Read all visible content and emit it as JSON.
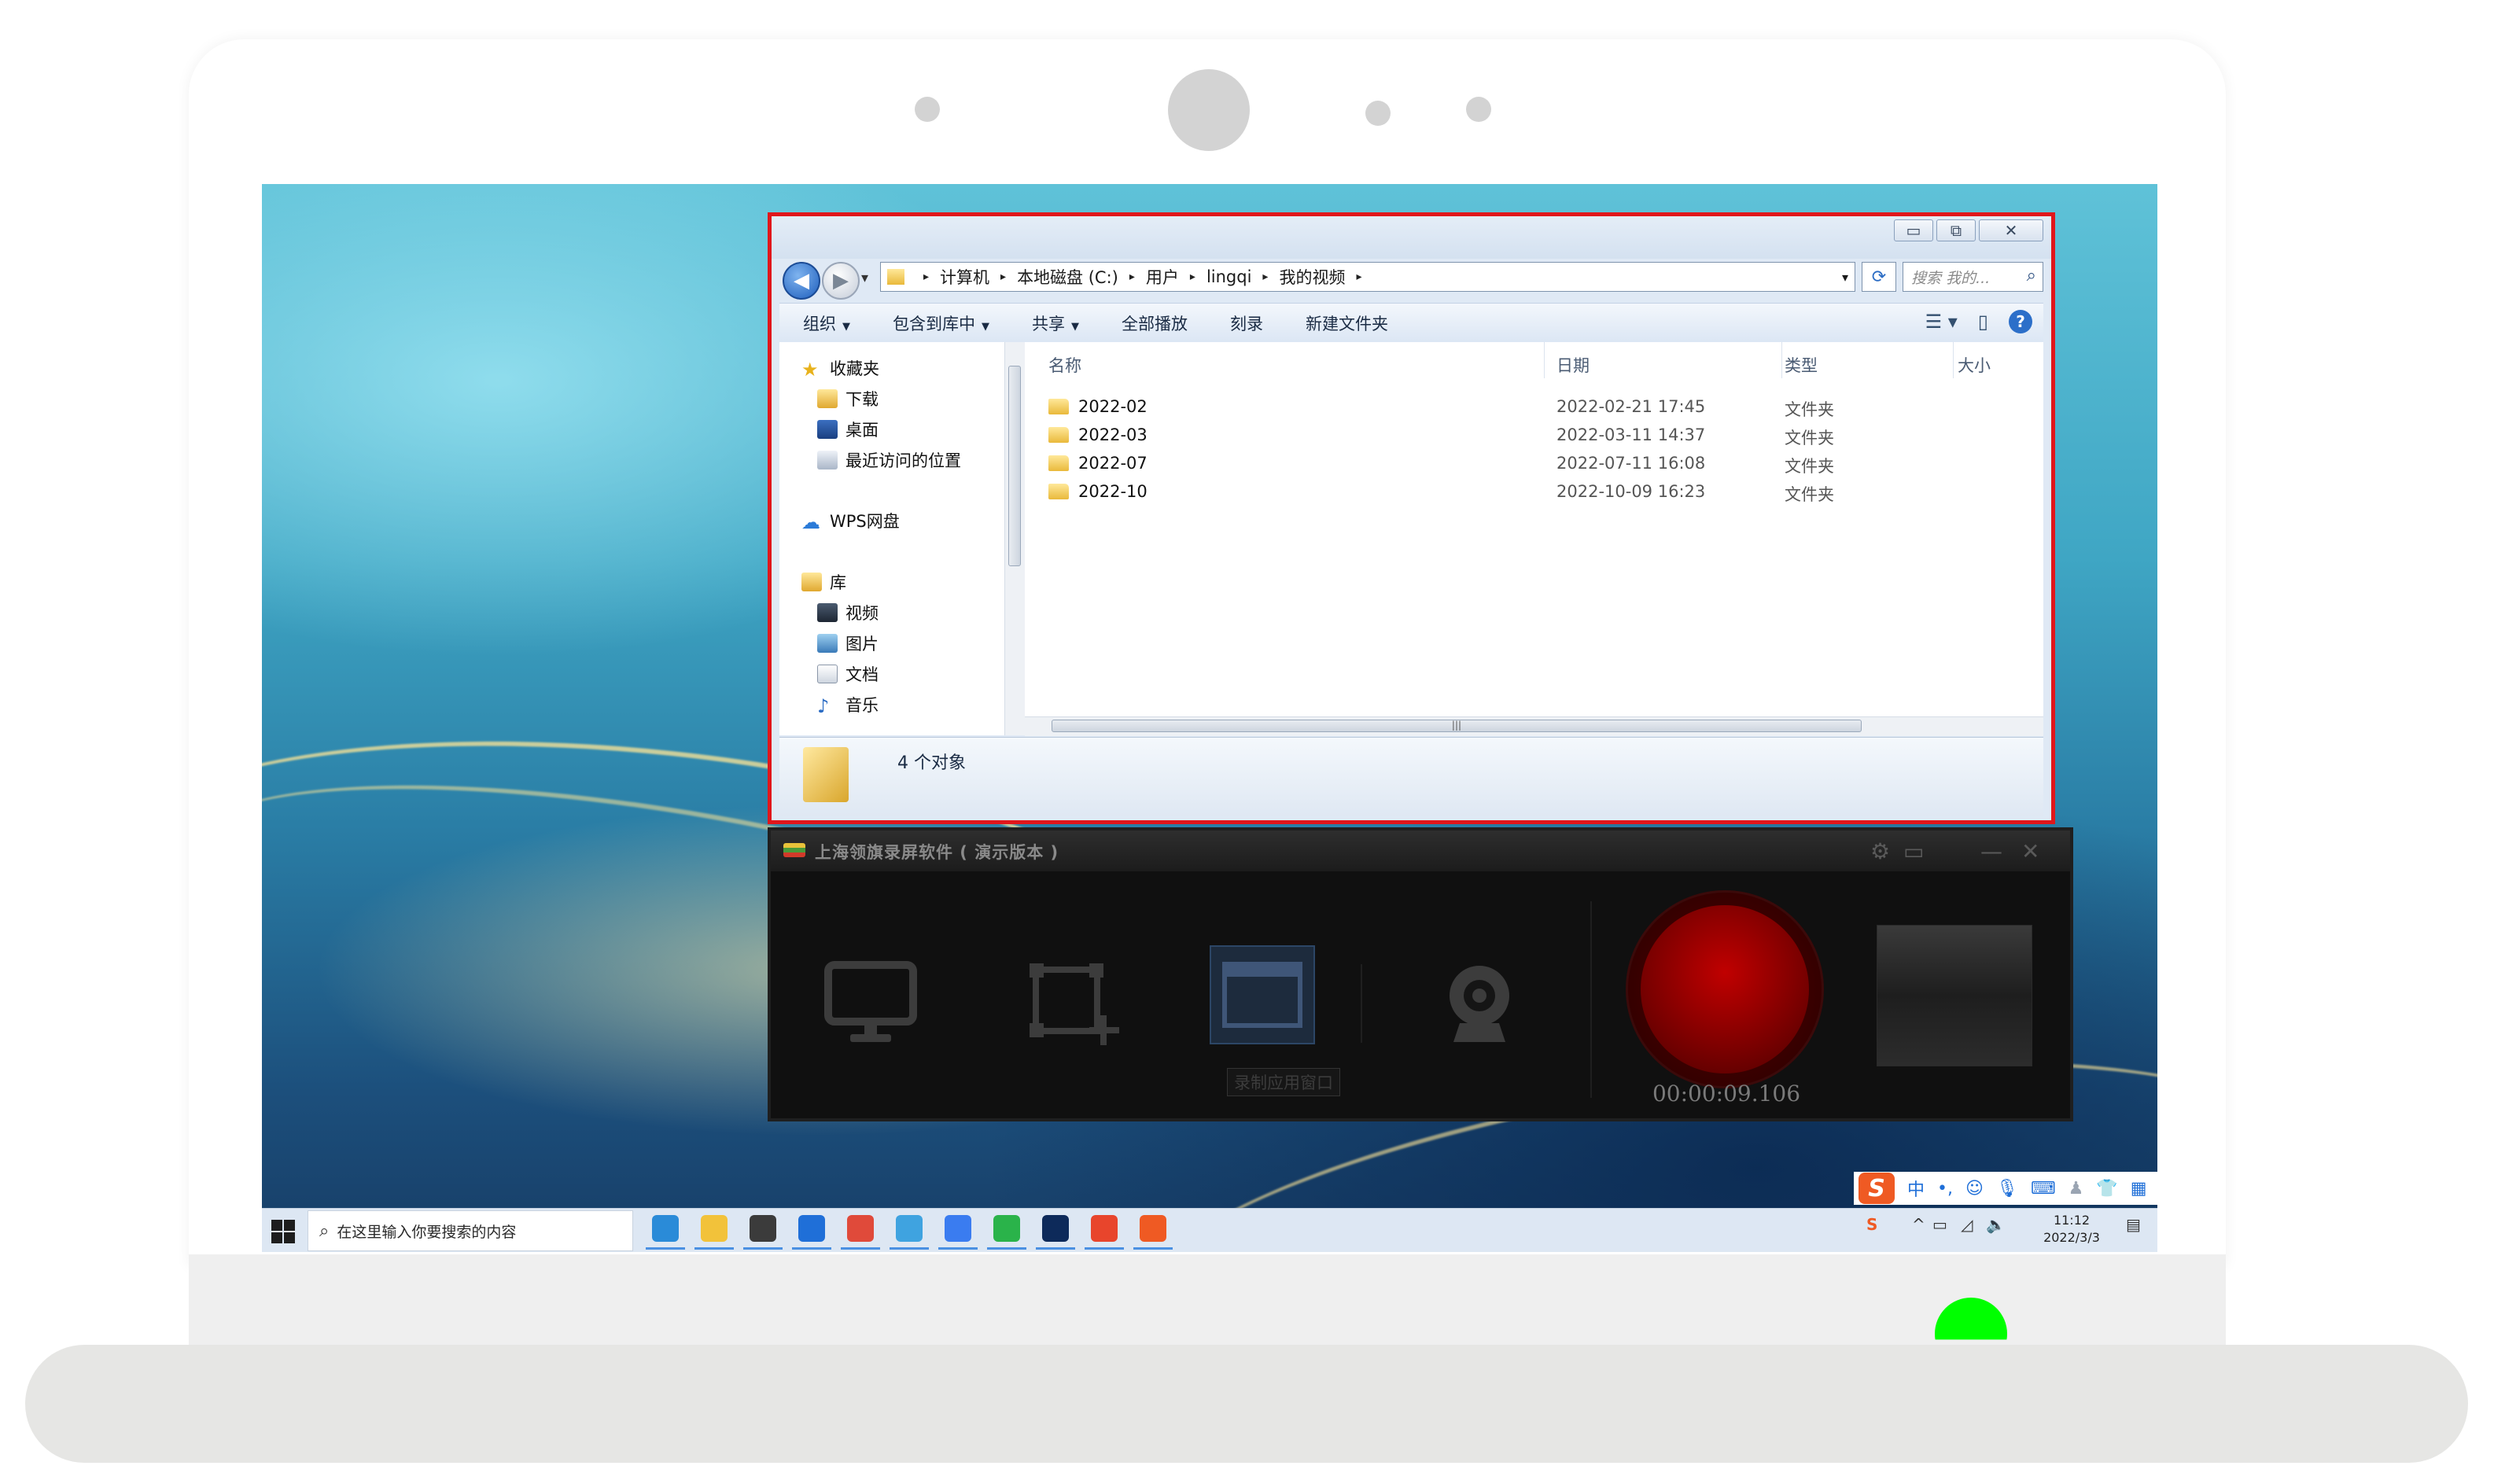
{
  "explorer": {
    "window_controls": {
      "minimize": "▭",
      "maximize": "⧉",
      "close": "✕"
    },
    "breadcrumb": [
      "计算机",
      "本地磁盘 (C:)",
      "用户",
      "lingqi",
      "我的视频"
    ],
    "search_placeholder": "搜索 我的...",
    "toolbar": [
      {
        "label": "组织",
        "dropdown": true
      },
      {
        "label": "包含到库中",
        "dropdown": true
      },
      {
        "label": "共享",
        "dropdown": true
      },
      {
        "label": "全部播放",
        "dropdown": false
      },
      {
        "label": "刻录",
        "dropdown": false
      },
      {
        "label": "新建文件夹",
        "dropdown": false
      }
    ],
    "nav": {
      "favorites": {
        "label": "收藏夹",
        "items": [
          "下载",
          "桌面",
          "最近访问的位置"
        ]
      },
      "wps": "WPS网盘",
      "library": {
        "label": "库",
        "items": [
          "视频",
          "图片",
          "文档",
          "音乐"
        ]
      }
    },
    "columns": {
      "name": "名称",
      "date": "日期",
      "type": "类型",
      "size": "大小"
    },
    "files": [
      {
        "name": "2022-02",
        "date": "2022-02-21 17:45",
        "type": "文件夹"
      },
      {
        "name": "2022-03",
        "date": "2022-03-11 14:37",
        "type": "文件夹"
      },
      {
        "name": "2022-07",
        "date": "2022-07-11 16:08",
        "type": "文件夹"
      },
      {
        "name": "2022-10",
        "date": "2022-10-09 16:23",
        "type": "文件夹"
      }
    ],
    "status": "4 个对象",
    "highlight_color": "#e0161b"
  },
  "recorder": {
    "title": "上海领旗录屏软件 ( 演示版本 )",
    "selected_mode_label": "录制应用窗口",
    "timer": "00:00:09.106",
    "record_color": "#b00000"
  },
  "taskbar": {
    "search_placeholder": "在这里输入你要搜索的内容",
    "apps": [
      {
        "name": "edge-icon",
        "color": "#2a8bd8"
      },
      {
        "name": "file-explorer-icon",
        "color": "#f2c23a"
      },
      {
        "name": "store-icon",
        "color": "#3b3b3b"
      },
      {
        "name": "mail-icon",
        "color": "#1f6fd8"
      },
      {
        "name": "chrome-icon",
        "color": "#e04a3a"
      },
      {
        "name": "ie-icon",
        "color": "#3fa3e0"
      },
      {
        "name": "feishu-icon",
        "color": "#3a7cf0"
      },
      {
        "name": "wechat-icon",
        "color": "#2ab34a"
      },
      {
        "name": "photoshop-icon",
        "color": "#0d2a5a"
      },
      {
        "name": "kingsoft-icon",
        "color": "#e8452c"
      },
      {
        "name": "wps-icon",
        "color": "#ef5a23"
      }
    ],
    "ime_label": "中",
    "clock_time": "11:12",
    "clock_date": "2022/3/3"
  }
}
